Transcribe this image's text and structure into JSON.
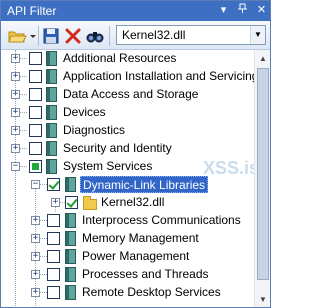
{
  "window": {
    "title": "API Filter"
  },
  "titlebar_icons": [
    "dropdown-arrow-icon",
    "pin-icon",
    "close-icon"
  ],
  "toolbar": {
    "buttons": [
      "open-folder-icon",
      "save-icon",
      "delete-icon",
      "find-icon"
    ],
    "module_combo": {
      "value": "Kernel32.dll"
    }
  },
  "tree": {
    "items": [
      {
        "label": "Additional Resources",
        "checked": "none",
        "expander": "+"
      },
      {
        "label": "Application Installation and Servicing",
        "checked": "none",
        "expander": "+"
      },
      {
        "label": "Data Access and Storage",
        "checked": "none",
        "expander": "+"
      },
      {
        "label": "Devices",
        "checked": "none",
        "expander": "+"
      },
      {
        "label": "Diagnostics",
        "checked": "none",
        "expander": "+"
      },
      {
        "label": "Security and Identity",
        "checked": "none",
        "expander": "+"
      },
      {
        "label": "System Services",
        "checked": "partial",
        "expander": "-"
      },
      {
        "label": "Dynamic-Link Libraries",
        "checked": "checked",
        "expander": "-",
        "selected": true
      },
      {
        "label": "Kernel32.dll",
        "checked": "checked",
        "expander": "+"
      },
      {
        "label": "Interprocess Communications",
        "checked": "none",
        "expander": "+"
      },
      {
        "label": "Memory Management",
        "checked": "none",
        "expander": "+"
      },
      {
        "label": "Power Management",
        "checked": "none",
        "expander": "+"
      },
      {
        "label": "Processes and Threads",
        "checked": "none",
        "expander": "+"
      },
      {
        "label": "Remote Desktop Services",
        "checked": "none",
        "expander": "+"
      }
    ]
  },
  "watermark": {
    "text": "XSS.is"
  },
  "colors": {
    "titlebar": "#3d6fc2",
    "selection": "#3166c8",
    "check": "#1a9e2e"
  }
}
